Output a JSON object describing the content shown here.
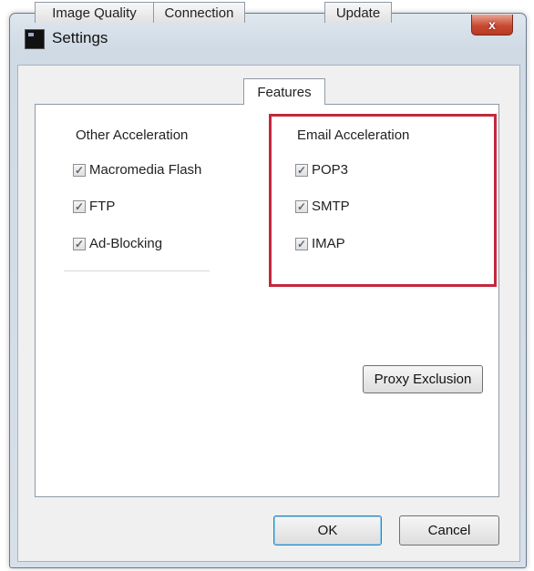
{
  "window": {
    "title": "Settings",
    "close_label": "x"
  },
  "tabs": [
    {
      "label": "Image Quality",
      "active": false
    },
    {
      "label": "Connection",
      "active": false
    },
    {
      "label": "Features",
      "active": true
    },
    {
      "label": "Update",
      "active": false
    }
  ],
  "other_acceleration": {
    "label": "Other Acceleration",
    "items": [
      {
        "label": "Macromedia Flash",
        "checked": true
      },
      {
        "label": "FTP",
        "checked": true
      },
      {
        "label": "Ad-Blocking",
        "checked": true
      }
    ]
  },
  "email_acceleration": {
    "label": "Email Acceleration",
    "items": [
      {
        "label": "POP3",
        "checked": true
      },
      {
        "label": "SMTP",
        "checked": true
      },
      {
        "label": "IMAP",
        "checked": true
      }
    ]
  },
  "buttons": {
    "proxy_exclusion": "Proxy Exclusion",
    "ok": "OK",
    "cancel": "Cancel"
  },
  "colors": {
    "highlight_border": "#c4273c",
    "close_button": "#c94b33"
  },
  "check_glyph": "✓"
}
